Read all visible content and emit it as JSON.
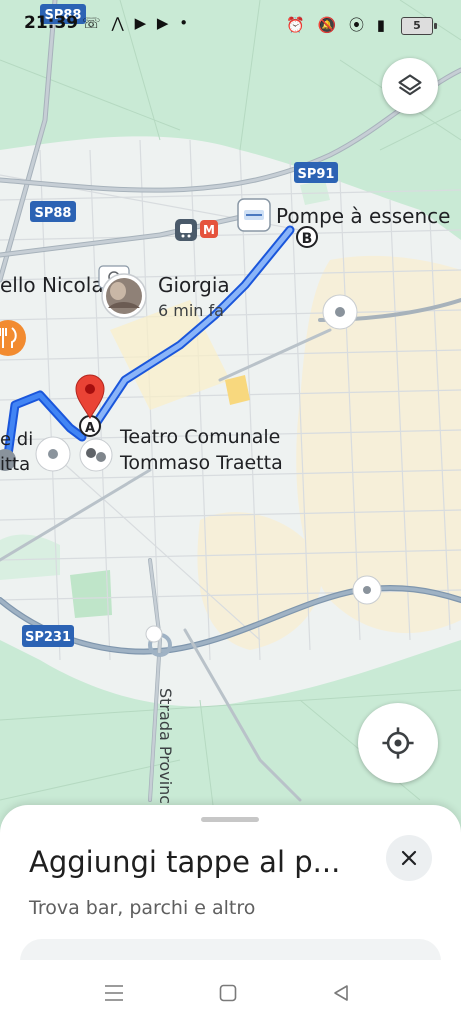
{
  "status_bar": {
    "time": "21:39",
    "left_icons": [
      "missed-call-icon",
      "app-icon",
      "youtube-icon",
      "youtube-icon",
      "dot-icon"
    ],
    "right_icons": [
      "alarm-icon",
      "mute-icon",
      "location-icon",
      "signal-4g-icon"
    ],
    "battery": "5"
  },
  "map": {
    "road_shields": [
      "SP88",
      "SP88",
      "SP91",
      "SP231"
    ],
    "place_labels": {
      "destination": "Pompe à essence",
      "left_cut": "ello Nicola",
      "contact_name": "Giorgia",
      "contact_time": "6 min fa",
      "theatre_line1": "Teatro Comunale",
      "theatre_line2": "Tommaso Traetta",
      "left_cut_2a": "e di",
      "left_cut_2b": "itta",
      "road_vertical": "Strada Provinci"
    },
    "markers": {
      "start": "A",
      "end": "B"
    },
    "colors": {
      "route": "#4285f4",
      "route_dark": "#1a56db",
      "pin": "#ea4335",
      "green": "#c8ebd3",
      "land": "#eef2f1",
      "sand": "#f6efd9"
    }
  },
  "controls": {
    "layers_icon": "layers-icon",
    "locate_icon": "my-location-icon"
  },
  "bottom_sheet": {
    "title": "Aggiungi tappe al p...",
    "subtitle": "Trova bar, parchi e altro",
    "close_icon": "close-icon"
  },
  "system_nav": [
    "menu-icon",
    "home-icon",
    "back-icon"
  ]
}
